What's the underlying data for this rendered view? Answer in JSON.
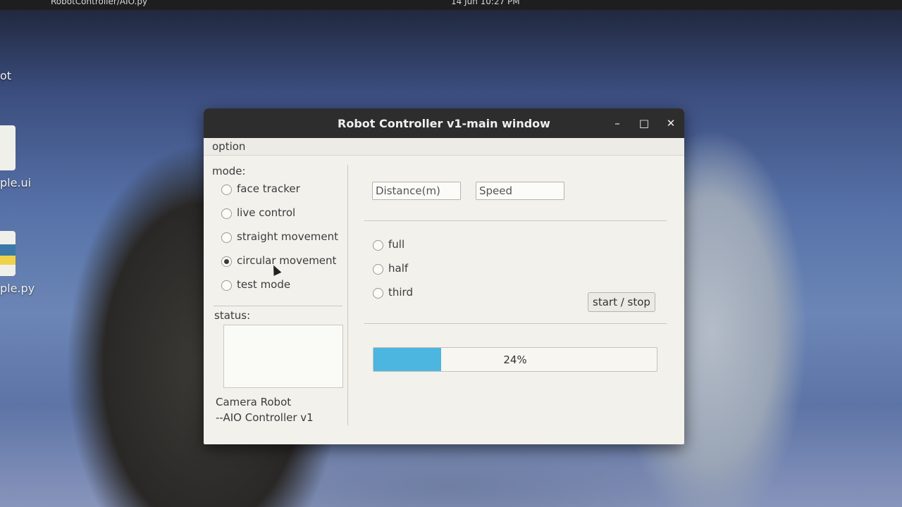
{
  "topbar": {
    "app_title": "RobotController/AIO.py",
    "clock": "14 Jun 10:27 PM"
  },
  "desktop": {
    "icon_labels": [
      "ot",
      "ple.ui",
      "ple.py"
    ]
  },
  "window": {
    "title": "Robot Controller v1-main window",
    "controls": {
      "minimize": "–",
      "maximize": "□",
      "close": "✕"
    },
    "menu": [
      "option"
    ]
  },
  "left_panel": {
    "mode_label": "mode:",
    "modes": [
      {
        "label": "face tracker",
        "selected": false
      },
      {
        "label": "live control",
        "selected": false
      },
      {
        "label": "straight movement",
        "selected": false
      },
      {
        "label": "circular movement",
        "selected": true
      },
      {
        "label": "test mode",
        "selected": false
      }
    ],
    "status_label": "status:",
    "status_text": "",
    "footer_line1": "Camera Robot",
    "footer_line2": "--AIO Controller v1"
  },
  "right_panel": {
    "distance": {
      "value": "",
      "placeholder": "Distance(m)"
    },
    "speed": {
      "value": "",
      "placeholder": "Speed"
    },
    "options": [
      {
        "label": "full",
        "selected": false
      },
      {
        "label": "half",
        "selected": false
      },
      {
        "label": "third",
        "selected": false
      }
    ],
    "start_stop_label": "start / stop",
    "progress": {
      "value": 24,
      "text": "24%",
      "color": "#4cb6e0"
    }
  }
}
